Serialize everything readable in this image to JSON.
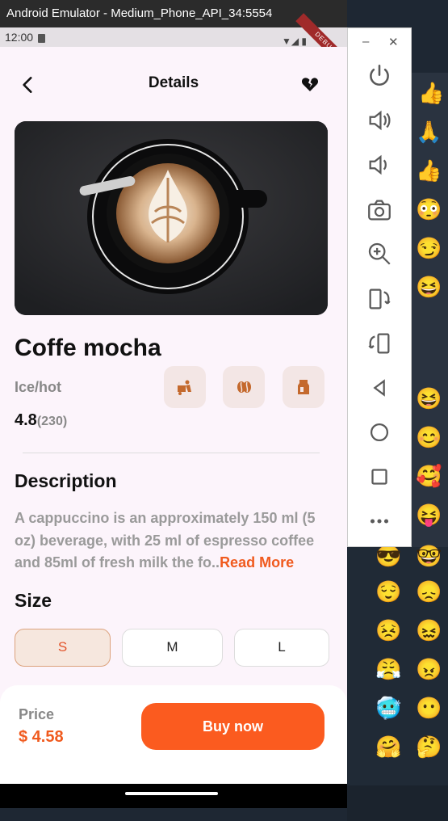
{
  "window": {
    "title": "Android Emulator - Medium_Phone_API_34:5554"
  },
  "status": {
    "time": "12:00",
    "debug": "DEBUG"
  },
  "header": {
    "title": "Details"
  },
  "product": {
    "name": "Coffe mocha",
    "subtitle": "Ice/hot",
    "rating": "4.8",
    "reviews": "(230)"
  },
  "description": {
    "heading": "Description",
    "text": "A cappuccino is an approximately 150 ml (5 oz) beverage, with 25 ml of espresso coffee and 85ml of fresh milk the fo..",
    "more": "Read More"
  },
  "size": {
    "heading": "Size",
    "options": [
      "S",
      "M",
      "L"
    ],
    "selected": "S"
  },
  "footer": {
    "price_label": "Price",
    "price": "$ 4.58",
    "buy": "Buy now"
  },
  "colors": {
    "accent": "#fb5b1f",
    "background": "#fcf4fb"
  },
  "icons": {
    "back": "back-arrow-icon",
    "favorite": "broken-heart-icon",
    "features": [
      "delivery-icon",
      "coffee-bean-icon",
      "milk-icon"
    ]
  }
}
